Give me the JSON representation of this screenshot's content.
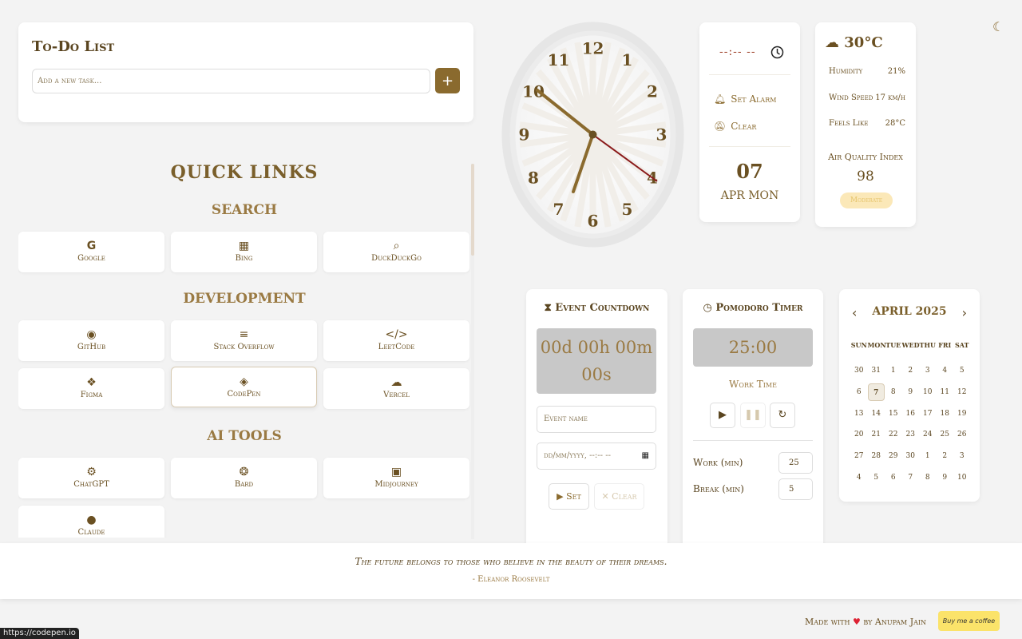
{
  "todo": {
    "title": "To-Do List",
    "placeholder": "Add a new task...",
    "add_label": "+"
  },
  "quick_links": {
    "title": "QUICK LINKS",
    "sections": [
      {
        "name": "SEARCH",
        "links": [
          {
            "label": "Google",
            "icon": "google-icon"
          },
          {
            "label": "Bing",
            "icon": "windows-icon"
          },
          {
            "label": "DuckDuckGo",
            "icon": "search-icon"
          }
        ]
      },
      {
        "name": "DEVELOPMENT",
        "links": [
          {
            "label": "GitHub",
            "icon": "github-icon"
          },
          {
            "label": "Stack Overflow",
            "icon": "stack-overflow-icon"
          },
          {
            "label": "LeetCode",
            "icon": "code-icon"
          },
          {
            "label": "Figma",
            "icon": "figma-icon"
          },
          {
            "label": "CodePen",
            "icon": "codepen-icon"
          },
          {
            "label": "Vercel",
            "icon": "cloud-icon"
          }
        ]
      },
      {
        "name": "AI TOOLS",
        "links": [
          {
            "label": "ChatGPT",
            "icon": "robot-icon"
          },
          {
            "label": "Bard",
            "icon": "brain-icon"
          },
          {
            "label": "Midjourney",
            "icon": "image-icon"
          },
          {
            "label": "Claude",
            "icon": "lightbulb-icon"
          }
        ]
      }
    ]
  },
  "clock": {
    "numbers": [
      "12",
      "1",
      "2",
      "3",
      "4",
      "5",
      "6",
      "7",
      "8",
      "9",
      "10",
      "11"
    ]
  },
  "alarm": {
    "time": "--:-- --",
    "set_label": "Set Alarm",
    "clear_label": "Clear",
    "day": "07",
    "month_weekday": "APR MON"
  },
  "weather": {
    "temp": "30°C",
    "humidity_label": "Humidity",
    "humidity": "21%",
    "wind_label": "Wind Speed",
    "wind": "17 km/h",
    "feels_label": "Feels Like",
    "feels": "28°C",
    "aqi_label": "Air Quality Index",
    "aqi": "98",
    "aqi_status": "Moderate"
  },
  "countdown": {
    "title": "Event Countdown",
    "display": "00d 00h 00m 00s",
    "name_placeholder": "Event name",
    "date_placeholder": "dd/mm/yyyy, --:-- --",
    "set_label": "Set",
    "clear_label": "Clear"
  },
  "pomodoro": {
    "title": "Pomodoro Timer",
    "display": "25:00",
    "mode": "Work Time",
    "work_label": "Work (min)",
    "work": "25",
    "break_label": "Break (min)",
    "break": "5"
  },
  "calendar": {
    "title": "APRIL 2025",
    "days": [
      "SUN",
      "MON",
      "TUE",
      "WED",
      "THU",
      "FRI",
      "SAT"
    ],
    "dates": [
      "30",
      "31",
      "1",
      "2",
      "3",
      "4",
      "5",
      "6",
      "7",
      "8",
      "9",
      "10",
      "11",
      "12",
      "13",
      "14",
      "15",
      "16",
      "17",
      "18",
      "19",
      "20",
      "21",
      "22",
      "23",
      "24",
      "25",
      "26",
      "27",
      "28",
      "29",
      "30",
      "1",
      "2",
      "3",
      "4",
      "5",
      "6",
      "7",
      "8",
      "9",
      "10"
    ],
    "today": "7"
  },
  "quote": {
    "text": "The future belongs to those who believe in the beauty of their dreams.",
    "author": "- Eleanor Roosevelt"
  },
  "footer": {
    "made_with": "Made with",
    "by": "by Anupam Jain",
    "coffee": "Buy me a coffee"
  },
  "status_url": "https://codepen.io"
}
